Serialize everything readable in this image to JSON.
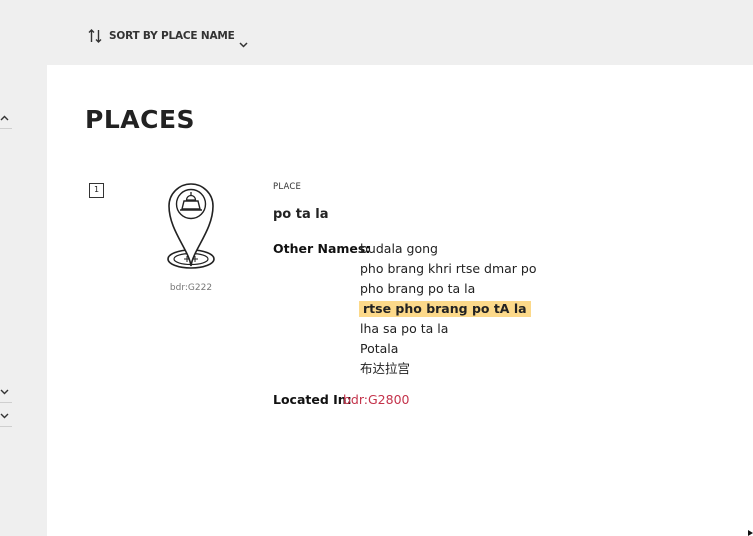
{
  "toolbar": {
    "sort_label": "SORT BY PLACE NAME",
    "sort_icon": "sort-arrows-icon",
    "dropdown_icon": "chevron-down-icon"
  },
  "left_rail": {
    "buttons": [
      {
        "icon": "chevron-up-icon"
      },
      {
        "icon": "chevron-down-icon"
      },
      {
        "icon": "chevron-down-icon"
      }
    ]
  },
  "main": {
    "title": "PLACES",
    "results": [
      {
        "index": "1",
        "icon": "place-pin-icon",
        "id": "bdr:G222",
        "type_label": "PLACE",
        "name": "po ta la",
        "other_names_label": "Other Names:",
        "other_names": [
          "budala gong",
          "pho brang khri rtse dmar po",
          "pho brang po ta la",
          "rtse pho brang po tA la",
          "lha sa po ta la",
          "Potala",
          "布达拉宫"
        ],
        "highlighted_name_index": 3,
        "located_in_label": "Located In:",
        "located_in_value": "bdr:G2800"
      }
    ]
  },
  "colors": {
    "background": "#efefef",
    "panel": "#ffffff",
    "highlight": "#fcd98a",
    "link": "#c4334b"
  }
}
